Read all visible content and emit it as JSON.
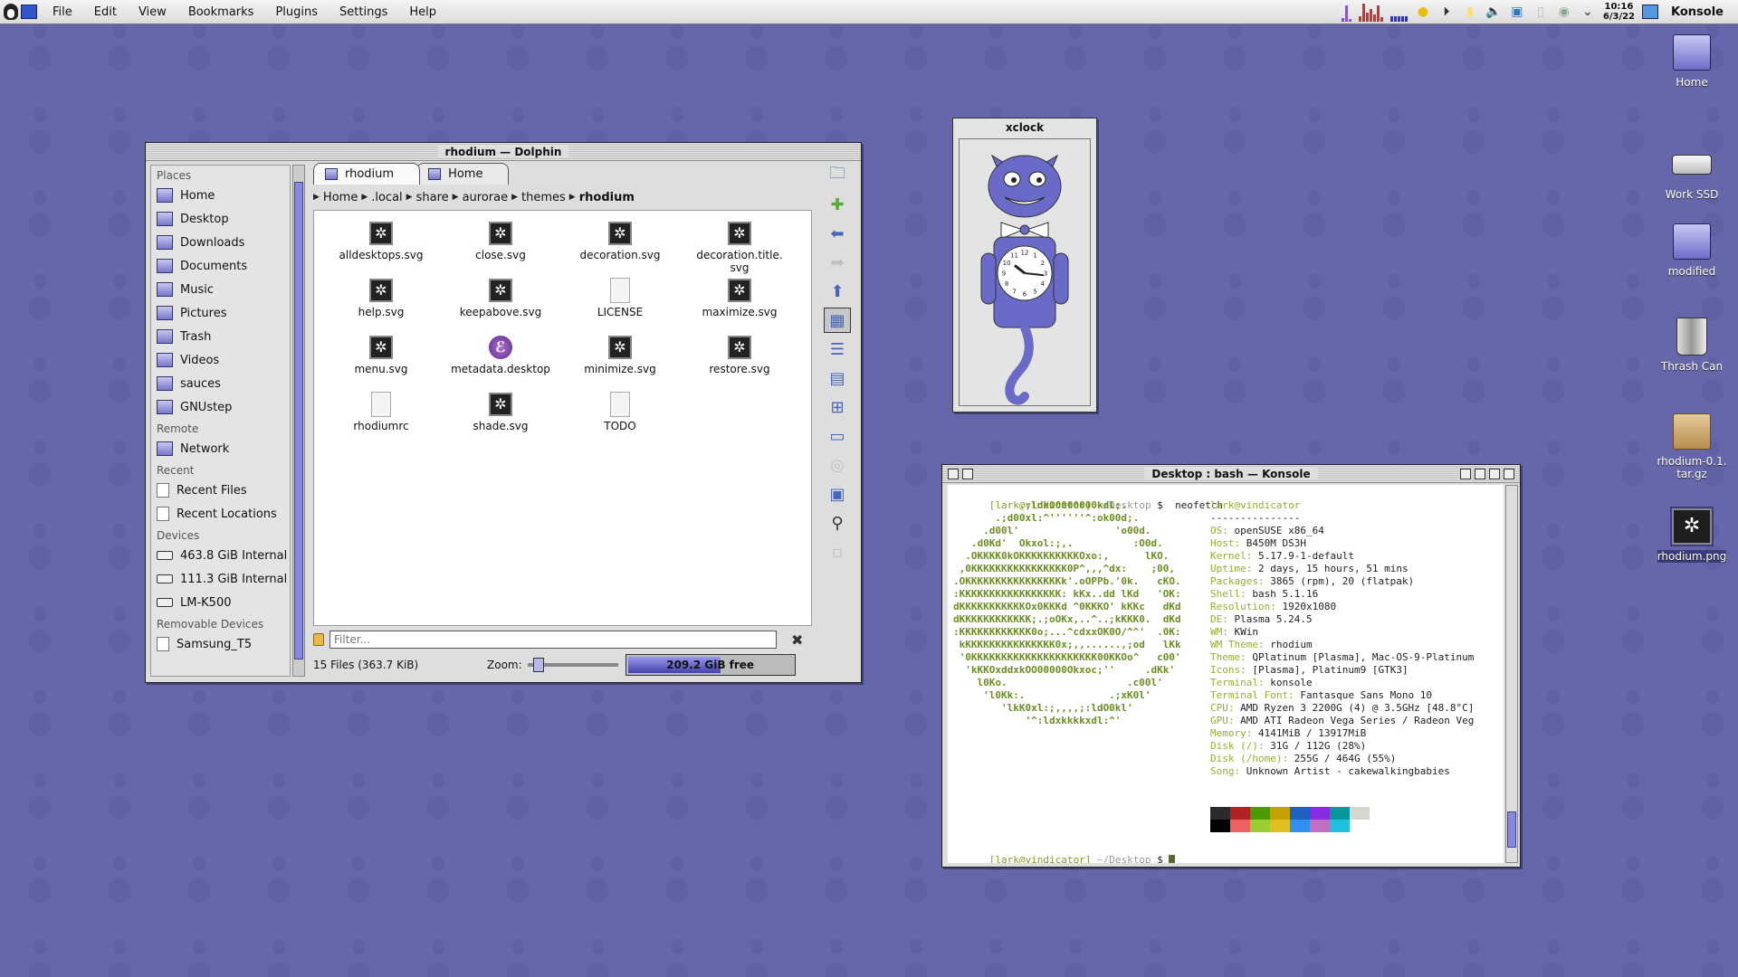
{
  "menubar": {
    "items": [
      "File",
      "Edit",
      "View",
      "Bookmarks",
      "Plugins",
      "Settings",
      "Help"
    ],
    "clock_time": "10:16",
    "clock_date": "6/3/22",
    "active_app": "Konsole"
  },
  "dolphin": {
    "title": "rhodium — Dolphin",
    "places": {
      "header": "Places",
      "items": [
        "Home",
        "Desktop",
        "Downloads",
        "Documents",
        "Music",
        "Pictures",
        "Trash",
        "Videos",
        "sauces",
        "GNUstep"
      ],
      "remote_header": "Remote",
      "remote_items": [
        "Network"
      ],
      "recent_header": "Recent",
      "recent_items": [
        "Recent Files",
        "Recent Locations"
      ],
      "devices_header": "Devices",
      "devices": [
        "463.8 GiB Internal ...",
        "111.3 GiB Internal ...",
        "LM-K500"
      ],
      "removable_header": "Removable Devices",
      "removable": [
        "Samsung_T5"
      ]
    },
    "tabs": [
      "rhodium",
      "Home"
    ],
    "breadcrumb": [
      "Home",
      ".local",
      "share",
      "aurorae",
      "themes",
      "rhodium"
    ],
    "files": [
      {
        "name": "alldesktops.svg",
        "type": "svg"
      },
      {
        "name": "close.svg",
        "type": "svg"
      },
      {
        "name": "decoration.svg",
        "type": "svg"
      },
      {
        "name": "decoration.title.\nsvg",
        "type": "svg"
      },
      {
        "name": "help.svg",
        "type": "svg"
      },
      {
        "name": "keepabove.svg",
        "type": "svg"
      },
      {
        "name": "LICENSE",
        "type": "text"
      },
      {
        "name": "maximize.svg",
        "type": "svg"
      },
      {
        "name": "menu.svg",
        "type": "svg"
      },
      {
        "name": "metadata.desktop",
        "type": "desktop"
      },
      {
        "name": "minimize.svg",
        "type": "svg"
      },
      {
        "name": "restore.svg",
        "type": "svg"
      },
      {
        "name": "rhodiumrc",
        "type": "text"
      },
      {
        "name": "shade.svg",
        "type": "svg"
      },
      {
        "name": "TODO",
        "type": "text"
      }
    ],
    "filter_placeholder": "Filter...",
    "status_count": "15 Files (363.7 KiB)",
    "zoom_label": "Zoom:",
    "free_space": "209.2 GiB free",
    "used_fraction": 0.55
  },
  "xclock": {
    "title": "xclock",
    "hour": 10,
    "minute": 16
  },
  "konsole": {
    "title": "Desktop : bash — Konsole",
    "prompt_user": "[lark@vindicator]",
    "prompt_dir": "~/Desktop",
    "prompt_symbol": "$",
    "command": "neofetch",
    "ascii": [
      "           .;ldkO0000000kdl;.",
      "       .;d00xl:^''''''^:ok00d;.",
      "     .d00l'                'o00d.",
      "   .d0Kd'  Okxol:;,.          :O0d.",
      "  .OKKKK0kOKKKKKKKKKKOxo:,      lKO.",
      " ,0KKKKKKKKKKKKKKKK0P^,,,^dx:    ;00,",
      ".OKKKKKKKKKKKKKKKKk'.oOPPb.'0k.   cKO.",
      ":KKKKKKKKKKKKKKKKK: kKx..dd lKd   'OK:",
      "dKKKKKKKKKKKOx0KKKd ^0KKKO' kKKc   dKd",
      "dKKKKKKKKKKKK;.;oOKx,..^..;kKKK0.  dKd",
      ":KKKKKKKKKKKK0o;...^cdxxOK0O/^^'  .0K:",
      " kKKKKKKKKKKKKKKK0x;,,......,;od   lKk",
      " '0KKKKKKKKKKKKKKKKKKKKK00KKOo^   c00'",
      "  'kKKOxddxkOO00000Okxoc;''     .dKk'",
      "    l0Ko.                    .c00l'",
      "     'l0Kk:.              .;xK0l'",
      "        'lkK0xl:;,,,,;:ldO0kl'",
      "            '^:ldxkkkkxdl:^'"
    ],
    "info_title": "lark@vindicator",
    "info_sep": "---------------",
    "info": [
      {
        "k": "OS",
        "v": "openSUSE x86_64"
      },
      {
        "k": "Host",
        "v": "B450M DS3H"
      },
      {
        "k": "Kernel",
        "v": "5.17.9-1-default"
      },
      {
        "k": "Uptime",
        "v": "2 days, 15 hours, 51 mins"
      },
      {
        "k": "Packages",
        "v": "3865 (rpm), 20 (flatpak)"
      },
      {
        "k": "Shell",
        "v": "bash 5.1.16"
      },
      {
        "k": "Resolution",
        "v": "1920x1080"
      },
      {
        "k": "DE",
        "v": "Plasma 5.24.5"
      },
      {
        "k": "WM",
        "v": "KWin"
      },
      {
        "k": "WM Theme",
        "v": "rhodium"
      },
      {
        "k": "Theme",
        "v": "QPlatinum [Plasma], Mac-OS-9-Platinum"
      },
      {
        "k": "Icons",
        "v": "[Plasma], Platinum9 [GTK3]"
      },
      {
        "k": "Terminal",
        "v": "konsole"
      },
      {
        "k": "Terminal Font",
        "v": "Fantasque Sans Mono 10"
      },
      {
        "k": "CPU",
        "v": "AMD Ryzen 3 2200G (4) @ 3.5GHz [48.8°C]"
      },
      {
        "k": "GPU",
        "v": "AMD ATI Radeon Vega Series / Radeon Veg"
      },
      {
        "k": "Memory",
        "v": "4141MiB / 13917MiB"
      },
      {
        "k": "Disk (/)",
        "v": "31G / 112G (28%)"
      },
      {
        "k": "Disk (/home)",
        "v": "255G / 464G (55%)"
      },
      {
        "k": "Song",
        "v": "Unknown Artist - cakewalkingbabies"
      }
    ],
    "palette": [
      "#2b2b2b",
      "#b22222",
      "#4e9a06",
      "#c4a000",
      "#2060c0",
      "#8a2be2",
      "#06989a",
      "#d3d7cf",
      "#000000",
      "#ef6060",
      "#9acd32",
      "#e0c020",
      "#3090f0",
      "#c070c0",
      "#20c0e0",
      "#ffffff"
    ]
  },
  "desktop_icons": [
    {
      "label": "Home",
      "kind": "folder"
    },
    {
      "label": "Work SSD",
      "kind": "drive"
    },
    {
      "label": "modified",
      "kind": "folder"
    },
    {
      "label": "Thrash Can",
      "kind": "trash"
    },
    {
      "label": "rhodium-0.1.\ntar.gz",
      "kind": "archive"
    },
    {
      "label": "rhodium.png",
      "kind": "image"
    }
  ]
}
